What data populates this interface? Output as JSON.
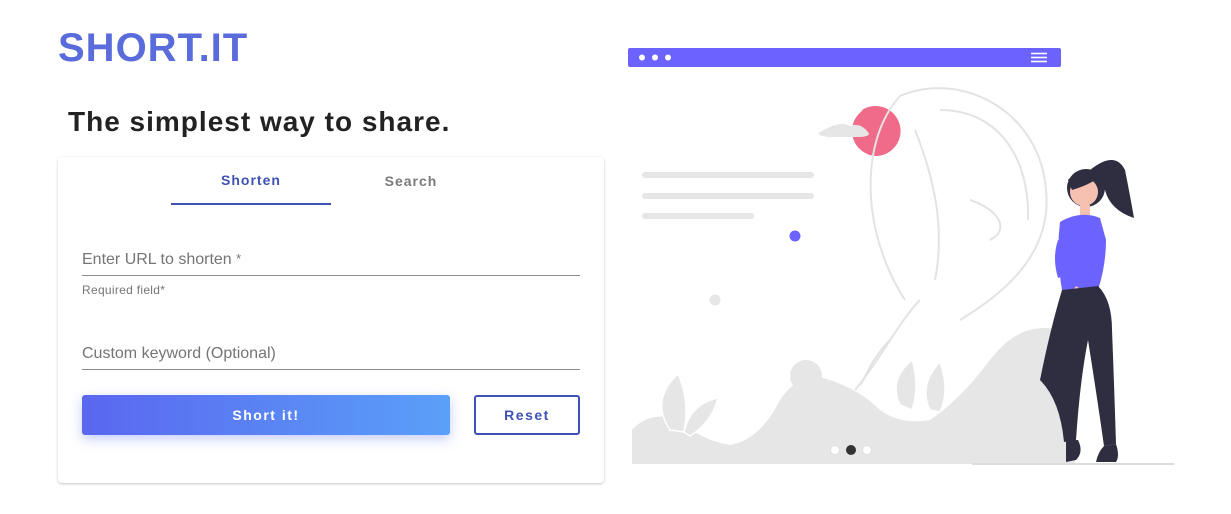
{
  "brand": {
    "logo": "SHORT.IT"
  },
  "hero": {
    "tagline": "The simplest way to share."
  },
  "tabs": [
    {
      "label": "Shorten",
      "active": true
    },
    {
      "label": "Search",
      "active": false
    }
  ],
  "form": {
    "url_label": "Enter URL to shorten",
    "required_marker": "*",
    "url_helper": "Required field*",
    "keyword_label": "Custom keyword (Optional)",
    "submit_label": "Short it!",
    "reset_label": "Reset"
  },
  "carousel": {
    "count": 3,
    "active_index": 1
  },
  "colors": {
    "brand": "#5a6bdc",
    "accent": "#3f51b5",
    "illustration_purple": "#6c63ff",
    "illustration_pink": "#f06b8a"
  },
  "icons": {
    "browser_menu": "hamburger-icon",
    "browser_controls": "window-dots-icon"
  }
}
